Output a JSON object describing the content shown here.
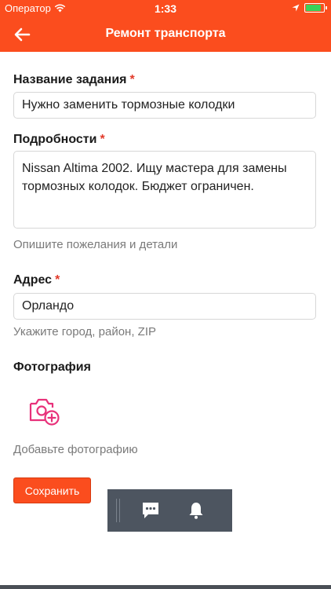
{
  "status_bar": {
    "carrier": "Оператор",
    "time": "1:33",
    "battery_level": 0.9
  },
  "nav": {
    "title": "Ремонт транспорта",
    "back_icon": "arrow-left-icon"
  },
  "form": {
    "required_mark": "*",
    "task_name": {
      "label": "Название задания",
      "value": "Нужно заменить тормозные колодки"
    },
    "details": {
      "label": "Подробности",
      "value": "Nissan Altima 2002. Ищу мастера для замены тормозных колодок. Бюджет ограничен.",
      "hint": "Опишите пожелания и детали"
    },
    "address": {
      "label": "Адрес",
      "value": "Орландо",
      "hint": "Укажите город, район, ZIP"
    },
    "photo": {
      "label": "Фотография",
      "hint": "Добавьте фотографию",
      "icon": "add-photo-icon"
    },
    "save_label": "Сохранить"
  },
  "overlay": {
    "icons": [
      "chat-icon",
      "bell-icon"
    ]
  },
  "colors": {
    "accent": "#fb4d1e",
    "photo_icon": "#e8317a",
    "overlay_bg": "#4d5560"
  }
}
